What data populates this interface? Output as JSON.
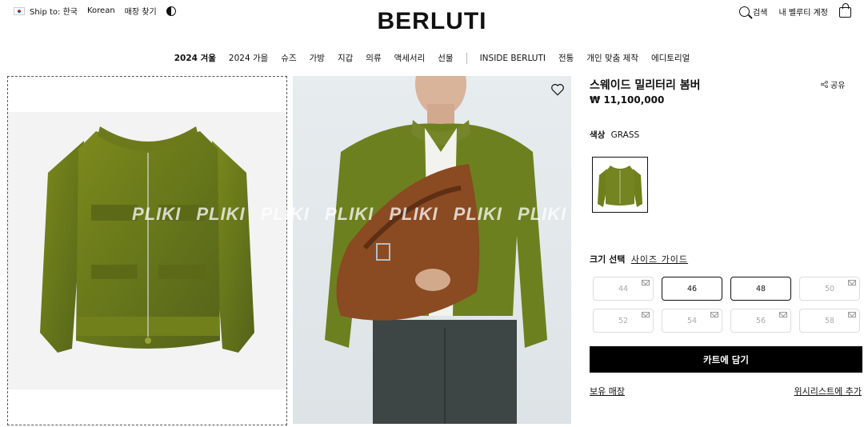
{
  "header": {
    "ship_to": "Ship to: 한국",
    "language": "Korean",
    "store_finder": "매장 찾기",
    "logo": "BERLUTI",
    "search": "검색",
    "account": "내 벨루티 계정"
  },
  "nav": {
    "items": [
      "2024 겨울",
      "2024 가을",
      "슈즈",
      "가방",
      "지갑",
      "의류",
      "액세서리",
      "선물"
    ],
    "items2": [
      "INSIDE BERLUTI",
      "전통",
      "개인 맞춤 제작",
      "에디토리얼"
    ]
  },
  "watermark": "PLIKI PLIKI PLIKI PLIKI PLIKI PLIKI PLIKI",
  "product": {
    "title": "스웨이드 밀리터리 봄버",
    "share": "공유",
    "price": "₩ 11,100,000",
    "color_label": "색상",
    "color_value": "GRASS",
    "size_label": "크기 선택",
    "size_guide": "사이즈 가이드",
    "sizes": [
      {
        "label": "44",
        "available": false
      },
      {
        "label": "46",
        "available": true
      },
      {
        "label": "48",
        "available": true
      },
      {
        "label": "50",
        "available": false
      },
      {
        "label": "52",
        "available": false
      },
      {
        "label": "54",
        "available": false
      },
      {
        "label": "56",
        "available": false
      },
      {
        "label": "58",
        "available": false
      }
    ],
    "add_to_cart": "카트에 담기",
    "stock_stores": "보유 매장",
    "add_wishlist": "위시리스트에 추가"
  }
}
